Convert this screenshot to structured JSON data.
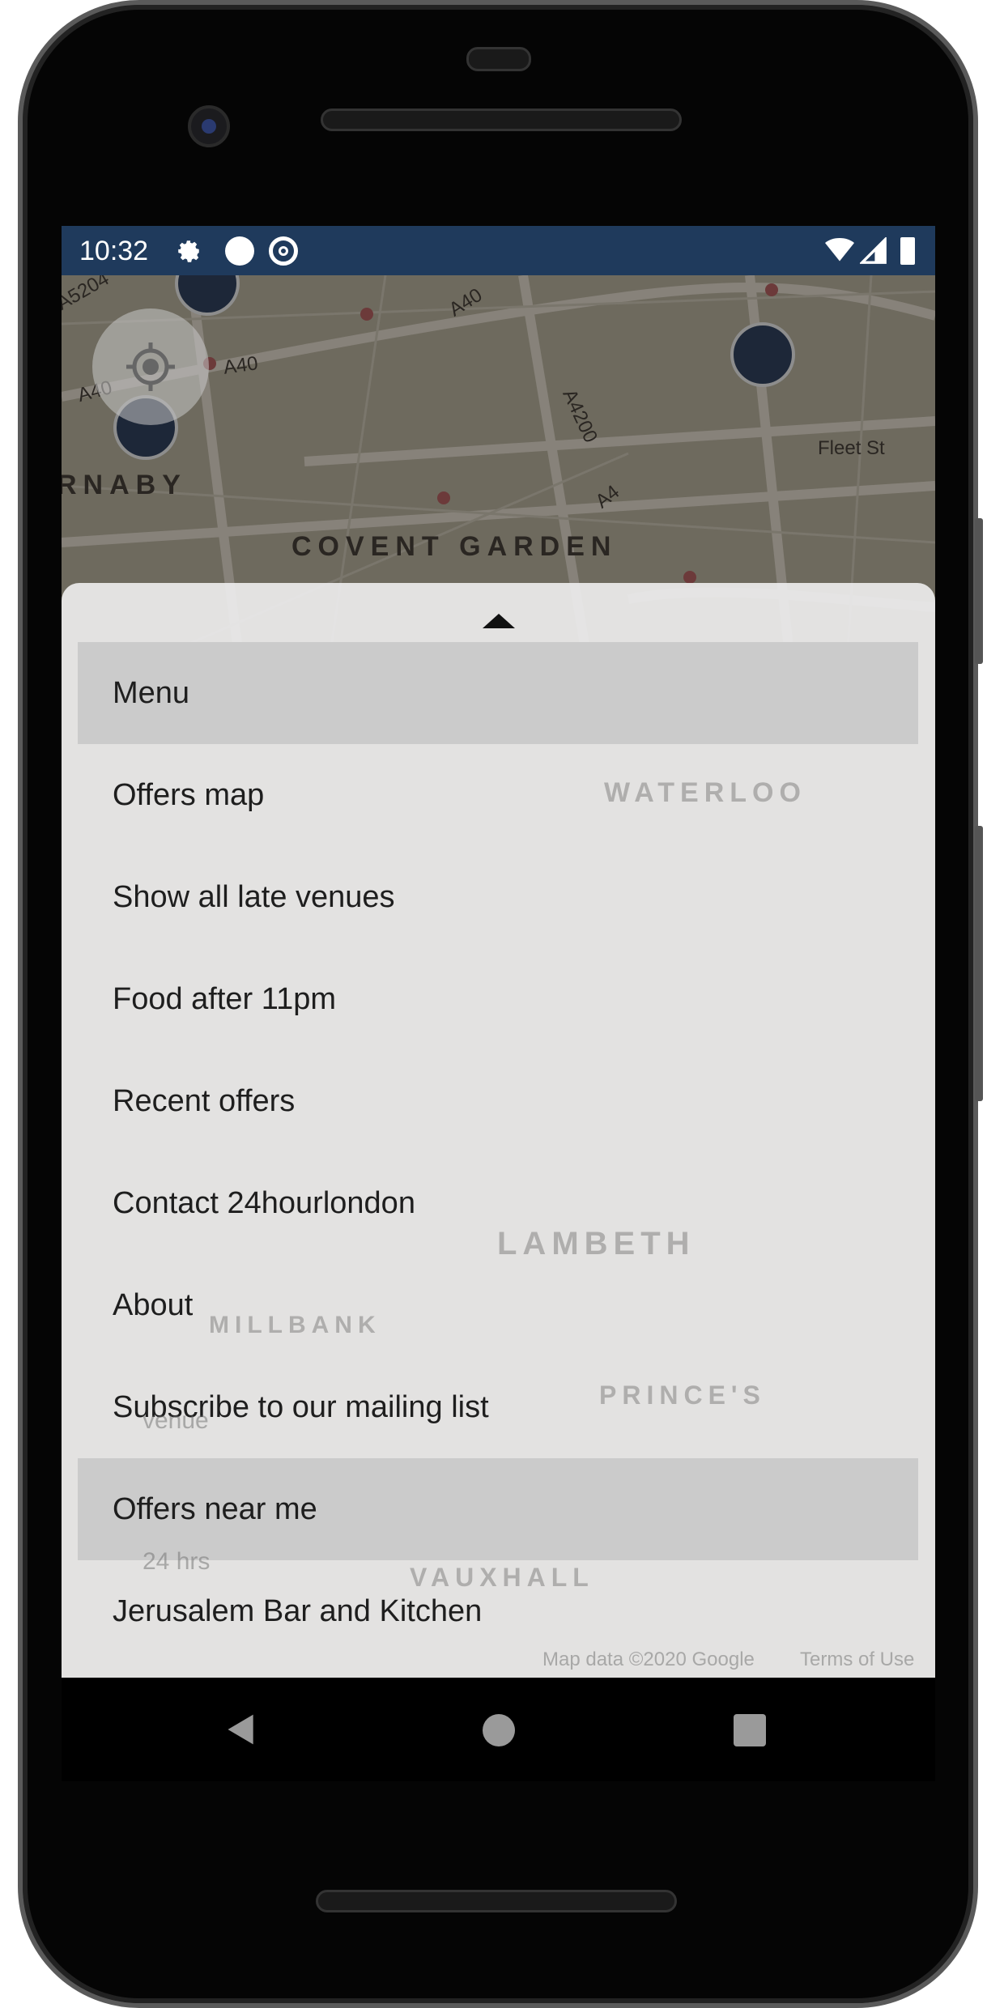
{
  "status_bar": {
    "time": "10:32",
    "icons": [
      "settings-icon",
      "circle-notification-icon",
      "data-saver-icon",
      "wifi-icon",
      "signal-icon",
      "battery-icon"
    ]
  },
  "map": {
    "labels": {
      "a5204": "A5204",
      "a40_1": "A40",
      "a40_2": "A40",
      "a40_3": "A40",
      "a4200": "A4200",
      "a4": "A4",
      "fleet": "Fleet St",
      "carnaby": "RNABY",
      "covent": "COVENT GARDEN"
    }
  },
  "sheet": {
    "background_map": {
      "waterloo": "WATERLOO",
      "lambeth": "LAMBETH",
      "millbank": "MILLBANK",
      "vauxhall": "VAUXHALL",
      "princes": "PRINCE'S",
      "venue": "venue",
      "hrs": "24 hrs",
      "map_data": "Map data ©2020 Google",
      "terms": "Terms of Use"
    },
    "items": [
      {
        "label": "Menu",
        "highlighted": true
      },
      {
        "label": "Offers map",
        "highlighted": false
      },
      {
        "label": "Show all late venues",
        "highlighted": false
      },
      {
        "label": "Food after 11pm",
        "highlighted": false
      },
      {
        "label": "Recent offers",
        "highlighted": false
      },
      {
        "label": "Contact 24hourlondon",
        "highlighted": false
      },
      {
        "label": "About",
        "highlighted": false
      },
      {
        "label": "Subscribe to our mailing list",
        "highlighted": false
      },
      {
        "label": "Offers near me",
        "highlighted": true
      },
      {
        "label": "Jerusalem Bar and Kitchen",
        "highlighted": false
      }
    ]
  },
  "colors": {
    "status_bar": "#1f3a5c",
    "highlight": "#cbcbcb"
  }
}
